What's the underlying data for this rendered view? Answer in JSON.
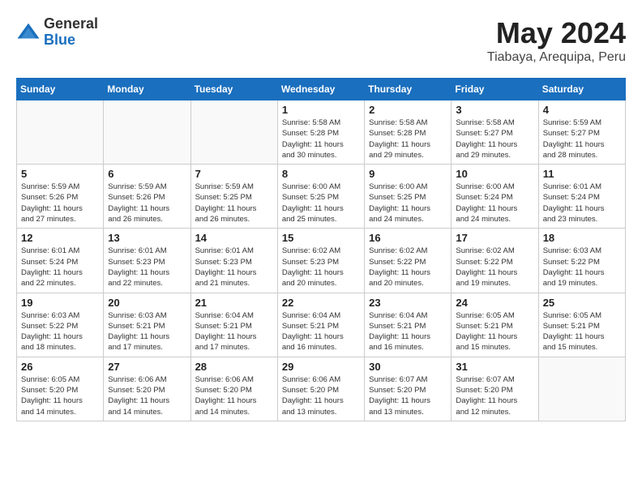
{
  "logo": {
    "general": "General",
    "blue": "Blue"
  },
  "title": "May 2024",
  "location": "Tiabaya, Arequipa, Peru",
  "days_of_week": [
    "Sunday",
    "Monday",
    "Tuesday",
    "Wednesday",
    "Thursday",
    "Friday",
    "Saturday"
  ],
  "weeks": [
    [
      {
        "day": "",
        "info": ""
      },
      {
        "day": "",
        "info": ""
      },
      {
        "day": "",
        "info": ""
      },
      {
        "day": "1",
        "info": "Sunrise: 5:58 AM\nSunset: 5:28 PM\nDaylight: 11 hours\nand 30 minutes."
      },
      {
        "day": "2",
        "info": "Sunrise: 5:58 AM\nSunset: 5:28 PM\nDaylight: 11 hours\nand 29 minutes."
      },
      {
        "day": "3",
        "info": "Sunrise: 5:58 AM\nSunset: 5:27 PM\nDaylight: 11 hours\nand 29 minutes."
      },
      {
        "day": "4",
        "info": "Sunrise: 5:59 AM\nSunset: 5:27 PM\nDaylight: 11 hours\nand 28 minutes."
      }
    ],
    [
      {
        "day": "5",
        "info": "Sunrise: 5:59 AM\nSunset: 5:26 PM\nDaylight: 11 hours\nand 27 minutes."
      },
      {
        "day": "6",
        "info": "Sunrise: 5:59 AM\nSunset: 5:26 PM\nDaylight: 11 hours\nand 26 minutes."
      },
      {
        "day": "7",
        "info": "Sunrise: 5:59 AM\nSunset: 5:25 PM\nDaylight: 11 hours\nand 26 minutes."
      },
      {
        "day": "8",
        "info": "Sunrise: 6:00 AM\nSunset: 5:25 PM\nDaylight: 11 hours\nand 25 minutes."
      },
      {
        "day": "9",
        "info": "Sunrise: 6:00 AM\nSunset: 5:25 PM\nDaylight: 11 hours\nand 24 minutes."
      },
      {
        "day": "10",
        "info": "Sunrise: 6:00 AM\nSunset: 5:24 PM\nDaylight: 11 hours\nand 24 minutes."
      },
      {
        "day": "11",
        "info": "Sunrise: 6:01 AM\nSunset: 5:24 PM\nDaylight: 11 hours\nand 23 minutes."
      }
    ],
    [
      {
        "day": "12",
        "info": "Sunrise: 6:01 AM\nSunset: 5:24 PM\nDaylight: 11 hours\nand 22 minutes."
      },
      {
        "day": "13",
        "info": "Sunrise: 6:01 AM\nSunset: 5:23 PM\nDaylight: 11 hours\nand 22 minutes."
      },
      {
        "day": "14",
        "info": "Sunrise: 6:01 AM\nSunset: 5:23 PM\nDaylight: 11 hours\nand 21 minutes."
      },
      {
        "day": "15",
        "info": "Sunrise: 6:02 AM\nSunset: 5:23 PM\nDaylight: 11 hours\nand 20 minutes."
      },
      {
        "day": "16",
        "info": "Sunrise: 6:02 AM\nSunset: 5:22 PM\nDaylight: 11 hours\nand 20 minutes."
      },
      {
        "day": "17",
        "info": "Sunrise: 6:02 AM\nSunset: 5:22 PM\nDaylight: 11 hours\nand 19 minutes."
      },
      {
        "day": "18",
        "info": "Sunrise: 6:03 AM\nSunset: 5:22 PM\nDaylight: 11 hours\nand 19 minutes."
      }
    ],
    [
      {
        "day": "19",
        "info": "Sunrise: 6:03 AM\nSunset: 5:22 PM\nDaylight: 11 hours\nand 18 minutes."
      },
      {
        "day": "20",
        "info": "Sunrise: 6:03 AM\nSunset: 5:21 PM\nDaylight: 11 hours\nand 17 minutes."
      },
      {
        "day": "21",
        "info": "Sunrise: 6:04 AM\nSunset: 5:21 PM\nDaylight: 11 hours\nand 17 minutes."
      },
      {
        "day": "22",
        "info": "Sunrise: 6:04 AM\nSunset: 5:21 PM\nDaylight: 11 hours\nand 16 minutes."
      },
      {
        "day": "23",
        "info": "Sunrise: 6:04 AM\nSunset: 5:21 PM\nDaylight: 11 hours\nand 16 minutes."
      },
      {
        "day": "24",
        "info": "Sunrise: 6:05 AM\nSunset: 5:21 PM\nDaylight: 11 hours\nand 15 minutes."
      },
      {
        "day": "25",
        "info": "Sunrise: 6:05 AM\nSunset: 5:21 PM\nDaylight: 11 hours\nand 15 minutes."
      }
    ],
    [
      {
        "day": "26",
        "info": "Sunrise: 6:05 AM\nSunset: 5:20 PM\nDaylight: 11 hours\nand 14 minutes."
      },
      {
        "day": "27",
        "info": "Sunrise: 6:06 AM\nSunset: 5:20 PM\nDaylight: 11 hours\nand 14 minutes."
      },
      {
        "day": "28",
        "info": "Sunrise: 6:06 AM\nSunset: 5:20 PM\nDaylight: 11 hours\nand 14 minutes."
      },
      {
        "day": "29",
        "info": "Sunrise: 6:06 AM\nSunset: 5:20 PM\nDaylight: 11 hours\nand 13 minutes."
      },
      {
        "day": "30",
        "info": "Sunrise: 6:07 AM\nSunset: 5:20 PM\nDaylight: 11 hours\nand 13 minutes."
      },
      {
        "day": "31",
        "info": "Sunrise: 6:07 AM\nSunset: 5:20 PM\nDaylight: 11 hours\nand 12 minutes."
      },
      {
        "day": "",
        "info": ""
      }
    ]
  ]
}
